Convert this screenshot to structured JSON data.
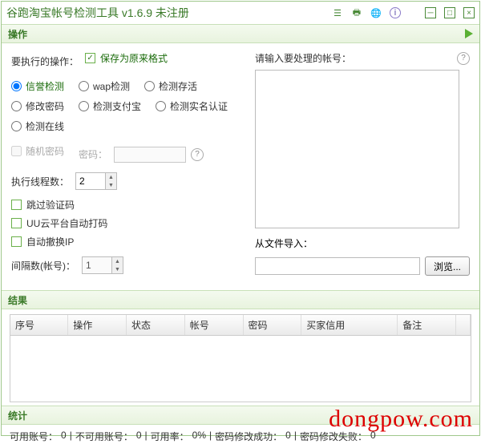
{
  "title": "谷跑淘宝帐号检测工具 v1.6.9 未注册",
  "sections": {
    "operate": "操作",
    "results": "结果",
    "stats": "统计"
  },
  "labels": {
    "exec_op": "要执行的操作：",
    "keep_format": "保存为原来格式",
    "threads": "执行线程数：",
    "password": "密码：",
    "rand_pwd": "随机密码",
    "skip_captcha": "跳过验证码",
    "uu_auto": "UU云平台自动打码",
    "auto_ip": "自动撤换IP",
    "interval": "间隔数(帐号)：",
    "input_prompt": "请输入要处理的帐号：",
    "from_file": "从文件导入："
  },
  "radios": {
    "r1": "信誉检测",
    "r2": "wap检测",
    "r3": "检测存活",
    "r4": "修改密码",
    "r5": "检测支付宝",
    "r6": "检测实名认证",
    "r7": "检测在线"
  },
  "values": {
    "threads": "2",
    "interval": "1"
  },
  "buttons": {
    "browse": "浏览..."
  },
  "table": {
    "h1": "序号",
    "h2": "操作",
    "h3": "状态",
    "h4": "帐号",
    "h5": "密码",
    "h6": "买家信用",
    "h7": "备注"
  },
  "stats": {
    "s1": "可用账号：",
    "v1": "0",
    "s2": "不可用账号：",
    "v2": "0",
    "s3": "可用率：",
    "v3": "0%",
    "s4": "密码修改成功：",
    "v4": "0",
    "s5": "密码修改失败：",
    "v5": "0"
  },
  "watermark": "dongpow.com"
}
